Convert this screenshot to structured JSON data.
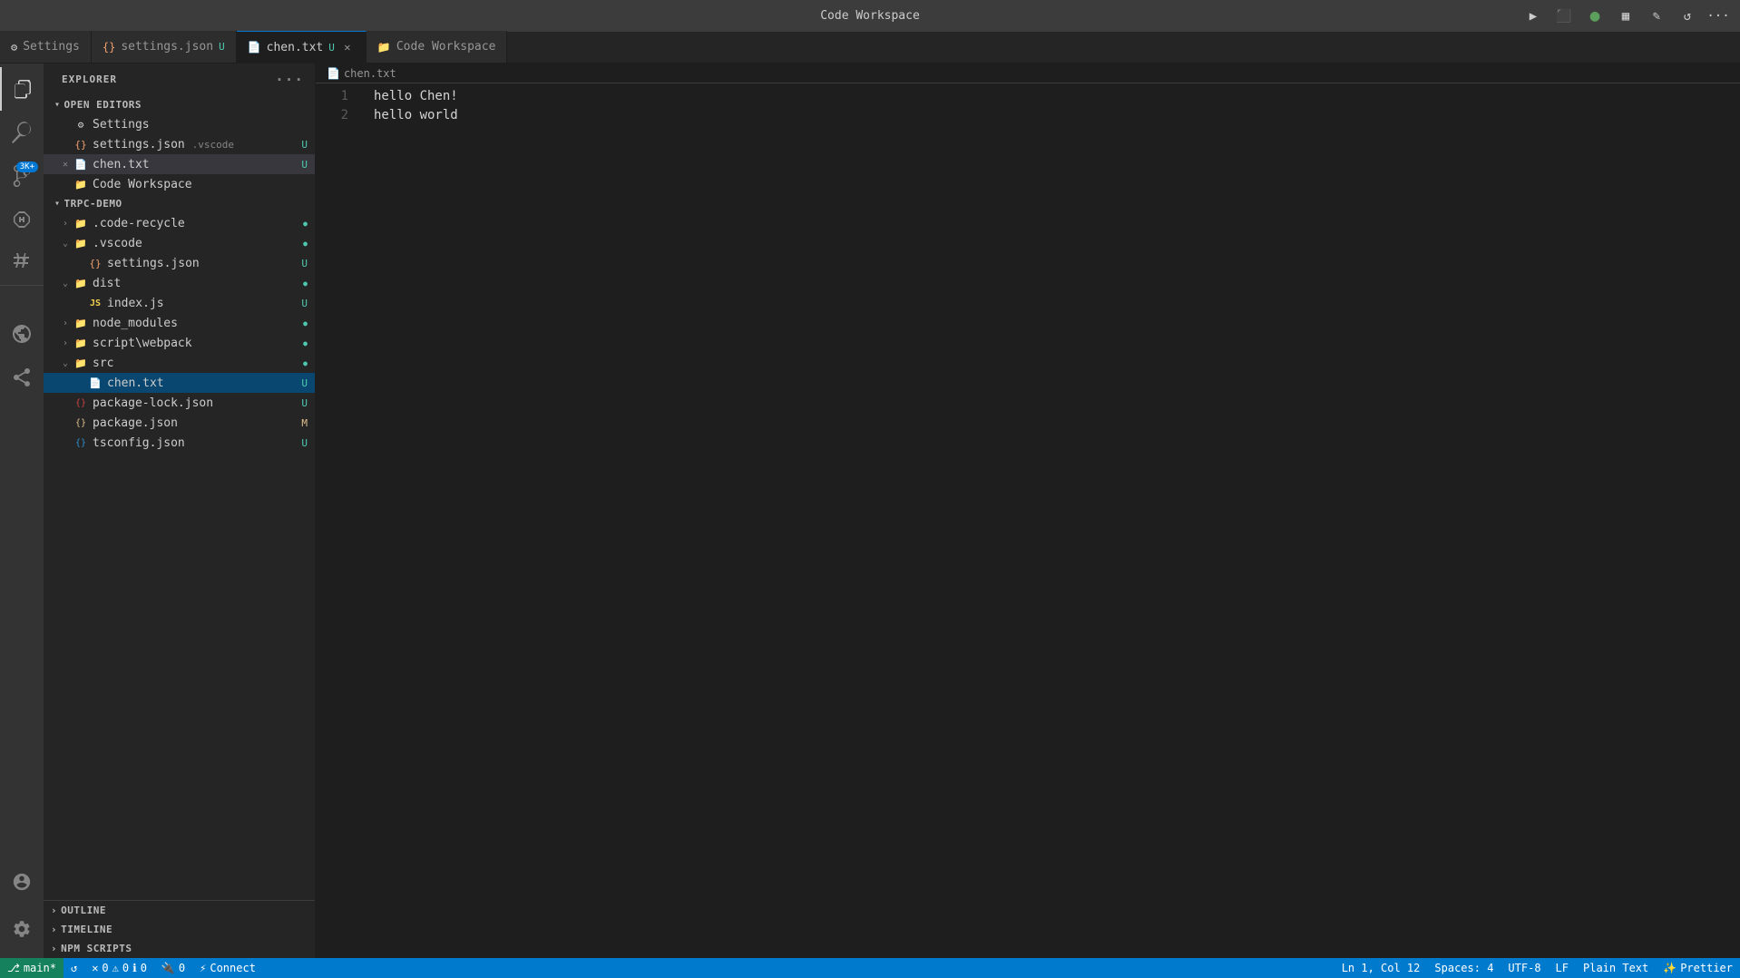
{
  "titleBar": {
    "title": "Code Workspace",
    "icons": {
      "run": "▶",
      "debug": "⬛",
      "profile": "👤",
      "layout": "▦",
      "customize": "✎",
      "remote": "↺",
      "more": "···"
    }
  },
  "tabs": [
    {
      "id": "settings",
      "label": "Settings",
      "icon": "⚙",
      "iconClass": "tab-icon-settings",
      "active": false,
      "modified": false,
      "closeable": false
    },
    {
      "id": "settings-json",
      "label": "settings.json",
      "icon": "{}",
      "iconClass": "tab-icon-json",
      "active": false,
      "modified": true,
      "dot": true,
      "closeable": false
    },
    {
      "id": "chen-txt",
      "label": "chen.txt",
      "icon": "📄",
      "iconClass": "tab-icon-txt",
      "active": true,
      "modified": true,
      "dot": false,
      "closeable": true
    },
    {
      "id": "code-workspace",
      "label": "Code Workspace",
      "icon": "📁",
      "iconClass": "tab-icon-workspace",
      "active": false,
      "modified": false,
      "closeable": false
    }
  ],
  "activityBar": {
    "items": [
      {
        "id": "explorer",
        "icon": "⎘",
        "active": true,
        "label": "Explorer"
      },
      {
        "id": "search",
        "icon": "🔍",
        "active": false,
        "label": "Search"
      },
      {
        "id": "source-control",
        "icon": "⎇",
        "active": false,
        "label": "Source Control",
        "badge": "3K+"
      },
      {
        "id": "run",
        "icon": "▷",
        "active": false,
        "label": "Run and Debug"
      },
      {
        "id": "extensions",
        "icon": "⧉",
        "active": false,
        "label": "Extensions"
      },
      {
        "id": "remote",
        "icon": "⊞",
        "active": false,
        "label": "Remote Explorer"
      },
      {
        "id": "live-share",
        "icon": "↑",
        "active": false,
        "label": "Live Share"
      }
    ],
    "bottom": [
      {
        "id": "account",
        "icon": "👤",
        "label": "Account"
      },
      {
        "id": "settings",
        "icon": "⚙",
        "label": "Manage"
      }
    ]
  },
  "sidebar": {
    "title": "EXPLORER",
    "sections": {
      "openEditors": {
        "label": "OPEN EDITORS",
        "items": [
          {
            "name": "Settings",
            "icon": "⚙",
            "iconClass": "icon-settings",
            "indent": 1
          },
          {
            "name": "settings.json .vscode",
            "icon": "{}",
            "iconClass": "icon-json",
            "indent": 1,
            "badge": "U",
            "badgeClass": "badge-u"
          },
          {
            "name": "chen.txt",
            "icon": "📄",
            "iconClass": "icon-txt",
            "indent": 1,
            "badge": "U",
            "badgeClass": "badge-u",
            "active": true
          },
          {
            "name": "Code Workspace",
            "icon": "📁",
            "iconClass": "icon-workspace",
            "indent": 1
          }
        ]
      },
      "trpcDemo": {
        "label": "TRPC-DEMO",
        "items": [
          {
            "name": ".code-recycle",
            "icon": "📁",
            "iconClass": "icon-folder",
            "indent": 1,
            "isDir": true,
            "expanded": false,
            "badge": "●",
            "badgeClass": "badge-green"
          },
          {
            "name": ".vscode",
            "icon": "📁",
            "iconClass": "icon-vscode-folder",
            "indent": 1,
            "isDir": true,
            "expanded": true,
            "badge": "●",
            "badgeClass": "badge-green"
          },
          {
            "name": "settings.json",
            "icon": "{}",
            "iconClass": "icon-json",
            "indent": 2,
            "badge": "U",
            "badgeClass": "badge-u"
          },
          {
            "name": "dist",
            "icon": "📁",
            "iconClass": "icon-folder",
            "indent": 1,
            "isDir": true,
            "expanded": true,
            "badge": "●",
            "badgeClass": "badge-green"
          },
          {
            "name": "index.js",
            "icon": "JS",
            "iconClass": "icon-js",
            "indent": 2,
            "badge": "U",
            "badgeClass": "badge-u"
          },
          {
            "name": "node_modules",
            "icon": "📁",
            "iconClass": "icon-folder",
            "indent": 1,
            "isDir": true,
            "expanded": false,
            "badge": "●",
            "badgeClass": "badge-green"
          },
          {
            "name": "script\\webpack",
            "icon": "📁",
            "iconClass": "icon-webpack",
            "indent": 1,
            "isDir": true,
            "expanded": false,
            "badge": "●",
            "badgeClass": "badge-green"
          },
          {
            "name": "src",
            "icon": "📁",
            "iconClass": "icon-folder",
            "indent": 1,
            "isDir": true,
            "expanded": false,
            "badge": "●",
            "badgeClass": "badge-green"
          },
          {
            "name": "chen.txt",
            "icon": "📄",
            "iconClass": "icon-txt",
            "indent": 2,
            "badge": "U",
            "badgeClass": "badge-u",
            "active": true
          },
          {
            "name": "package-lock.json",
            "icon": "{}",
            "iconClass": "icon-npm",
            "indent": 1,
            "badge": "U",
            "badgeClass": "badge-u"
          },
          {
            "name": "package.json",
            "icon": "{}",
            "iconClass": "icon-package",
            "indent": 1,
            "badge": "M",
            "badgeClass": "badge-m"
          },
          {
            "name": "tsconfig.json",
            "icon": "{}",
            "iconClass": "icon-ts",
            "indent": 1,
            "badge": "U",
            "badgeClass": "badge-u"
          }
        ]
      }
    },
    "bottomSections": [
      {
        "id": "outline",
        "label": "OUTLINE"
      },
      {
        "id": "timeline",
        "label": "TIMELINE"
      },
      {
        "id": "npm-scripts",
        "label": "NPM SCRIPTS"
      }
    ]
  },
  "editor": {
    "filename": "chen.txt",
    "breadcrumb": "chen.txt",
    "lines": [
      {
        "number": "1",
        "content": "hello Chen!"
      },
      {
        "number": "2",
        "content": "hello world"
      }
    ]
  },
  "statusBar": {
    "branch": "main*",
    "sync": "↺",
    "errors": "0",
    "warnings": "0",
    "info": "0",
    "port": "0",
    "remote": "Connect",
    "position": "Ln 1, Col 12",
    "spaces": "Spaces: 4",
    "encoding": "UTF-8",
    "lineEnding": "LF",
    "language": "Plain Text",
    "prettier": "Prettier"
  }
}
